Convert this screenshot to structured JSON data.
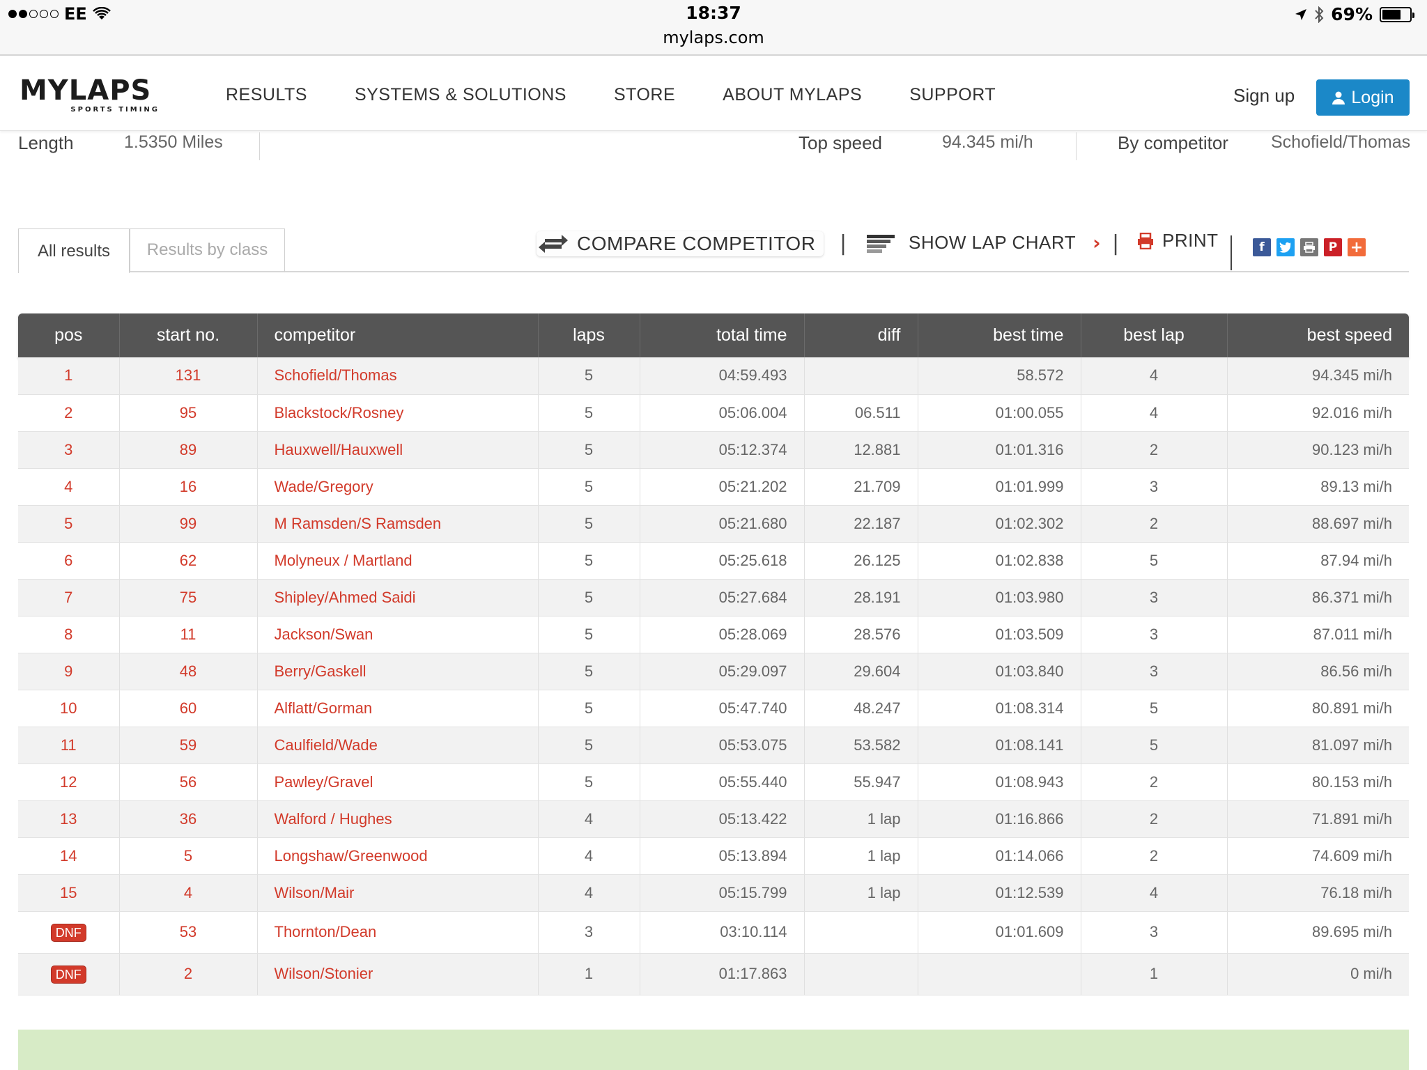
{
  "status_bar": {
    "carrier": "EE",
    "time": "18:37",
    "url": "mylaps.com",
    "battery": "69%",
    "battery_level": 0.69
  },
  "header": {
    "logo_text": "MYLAPS",
    "logo_subtext": "SPORTS TIMING",
    "nav": [
      "RESULTS",
      "SYSTEMS & SOLUTIONS",
      "STORE",
      "ABOUT MYLAPS",
      "SUPPORT"
    ],
    "signup_label": "Sign up",
    "login_label": "Login",
    "accent_color": "#1b88c8"
  },
  "track_info": {
    "length_label": "Length",
    "length_value": "1.5350 Miles",
    "top_speed_label": "Top speed",
    "top_speed_value": "94.345 mi/h",
    "by_competitor_label": "By competitor",
    "by_competitor_value": "Schofield/Thomas"
  },
  "tabs": {
    "all_results": "All results",
    "results_by_class": "Results by class"
  },
  "toolbar": {
    "compare_label": "COMPARE COMPETITOR",
    "lap_chart_label": "SHOW LAP CHART",
    "print_label": "PRINT",
    "share_icons": [
      "facebook-icon",
      "twitter-icon",
      "print-share-icon",
      "pinterest-icon",
      "plus-icon"
    ]
  },
  "table": {
    "headers": [
      "pos",
      "start no.",
      "competitor",
      "laps",
      "total time",
      "diff",
      "best time",
      "best lap",
      "best speed"
    ],
    "rows": [
      {
        "pos": "1",
        "start_no": "131",
        "competitor": "Schofield/Thomas",
        "laps": "5",
        "total_time": "04:59.493",
        "diff": "",
        "best_time": "58.572",
        "best_lap": "4",
        "best_speed": "94.345 mi/h"
      },
      {
        "pos": "2",
        "start_no": "95",
        "competitor": "Blackstock/Rosney",
        "laps": "5",
        "total_time": "05:06.004",
        "diff": "06.511",
        "best_time": "01:00.055",
        "best_lap": "4",
        "best_speed": "92.016 mi/h"
      },
      {
        "pos": "3",
        "start_no": "89",
        "competitor": "Hauxwell/Hauxwell",
        "laps": "5",
        "total_time": "05:12.374",
        "diff": "12.881",
        "best_time": "01:01.316",
        "best_lap": "2",
        "best_speed": "90.123 mi/h"
      },
      {
        "pos": "4",
        "start_no": "16",
        "competitor": "Wade/Gregory",
        "laps": "5",
        "total_time": "05:21.202",
        "diff": "21.709",
        "best_time": "01:01.999",
        "best_lap": "3",
        "best_speed": "89.13 mi/h"
      },
      {
        "pos": "5",
        "start_no": "99",
        "competitor": "M Ramsden/S Ramsden",
        "laps": "5",
        "total_time": "05:21.680",
        "diff": "22.187",
        "best_time": "01:02.302",
        "best_lap": "2",
        "best_speed": "88.697 mi/h"
      },
      {
        "pos": "6",
        "start_no": "62",
        "competitor": "Molyneux / Martland",
        "laps": "5",
        "total_time": "05:25.618",
        "diff": "26.125",
        "best_time": "01:02.838",
        "best_lap": "5",
        "best_speed": "87.94 mi/h"
      },
      {
        "pos": "7",
        "start_no": "75",
        "competitor": "Shipley/Ahmed Saidi",
        "laps": "5",
        "total_time": "05:27.684",
        "diff": "28.191",
        "best_time": "01:03.980",
        "best_lap": "3",
        "best_speed": "86.371 mi/h"
      },
      {
        "pos": "8",
        "start_no": "11",
        "competitor": "Jackson/Swan",
        "laps": "5",
        "total_time": "05:28.069",
        "diff": "28.576",
        "best_time": "01:03.509",
        "best_lap": "3",
        "best_speed": "87.011 mi/h"
      },
      {
        "pos": "9",
        "start_no": "48",
        "competitor": "Berry/Gaskell",
        "laps": "5",
        "total_time": "05:29.097",
        "diff": "29.604",
        "best_time": "01:03.840",
        "best_lap": "3",
        "best_speed": "86.56 mi/h"
      },
      {
        "pos": "10",
        "start_no": "60",
        "competitor": "Alflatt/Gorman",
        "laps": "5",
        "total_time": "05:47.740",
        "diff": "48.247",
        "best_time": "01:08.314",
        "best_lap": "5",
        "best_speed": "80.891 mi/h"
      },
      {
        "pos": "11",
        "start_no": "59",
        "competitor": "Caulfield/Wade",
        "laps": "5",
        "total_time": "05:53.075",
        "diff": "53.582",
        "best_time": "01:08.141",
        "best_lap": "5",
        "best_speed": "81.097 mi/h"
      },
      {
        "pos": "12",
        "start_no": "56",
        "competitor": "Pawley/Gravel",
        "laps": "5",
        "total_time": "05:55.440",
        "diff": "55.947",
        "best_time": "01:08.943",
        "best_lap": "2",
        "best_speed": "80.153 mi/h"
      },
      {
        "pos": "13",
        "start_no": "36",
        "competitor": "Walford / Hughes",
        "laps": "4",
        "total_time": "05:13.422",
        "diff": "1 lap",
        "best_time": "01:16.866",
        "best_lap": "2",
        "best_speed": "71.891 mi/h"
      },
      {
        "pos": "14",
        "start_no": "5",
        "competitor": "Longshaw/Greenwood",
        "laps": "4",
        "total_time": "05:13.894",
        "diff": "1 lap",
        "best_time": "01:14.066",
        "best_lap": "2",
        "best_speed": "74.609 mi/h"
      },
      {
        "pos": "15",
        "start_no": "4",
        "competitor": "Wilson/Mair",
        "laps": "4",
        "total_time": "05:15.799",
        "diff": "1 lap",
        "best_time": "01:12.539",
        "best_lap": "4",
        "best_speed": "76.18 mi/h"
      },
      {
        "pos": "DNF",
        "start_no": "53",
        "competitor": "Thornton/Dean",
        "laps": "3",
        "total_time": "03:10.114",
        "diff": "",
        "best_time": "01:01.609",
        "best_lap": "3",
        "best_speed": "89.695 mi/h"
      },
      {
        "pos": "DNF",
        "start_no": "2",
        "competitor": "Wilson/Stonier",
        "laps": "1",
        "total_time": "01:17.863",
        "diff": "",
        "best_time": "",
        "best_lap": "1",
        "best_speed": "0 mi/h"
      }
    ]
  }
}
